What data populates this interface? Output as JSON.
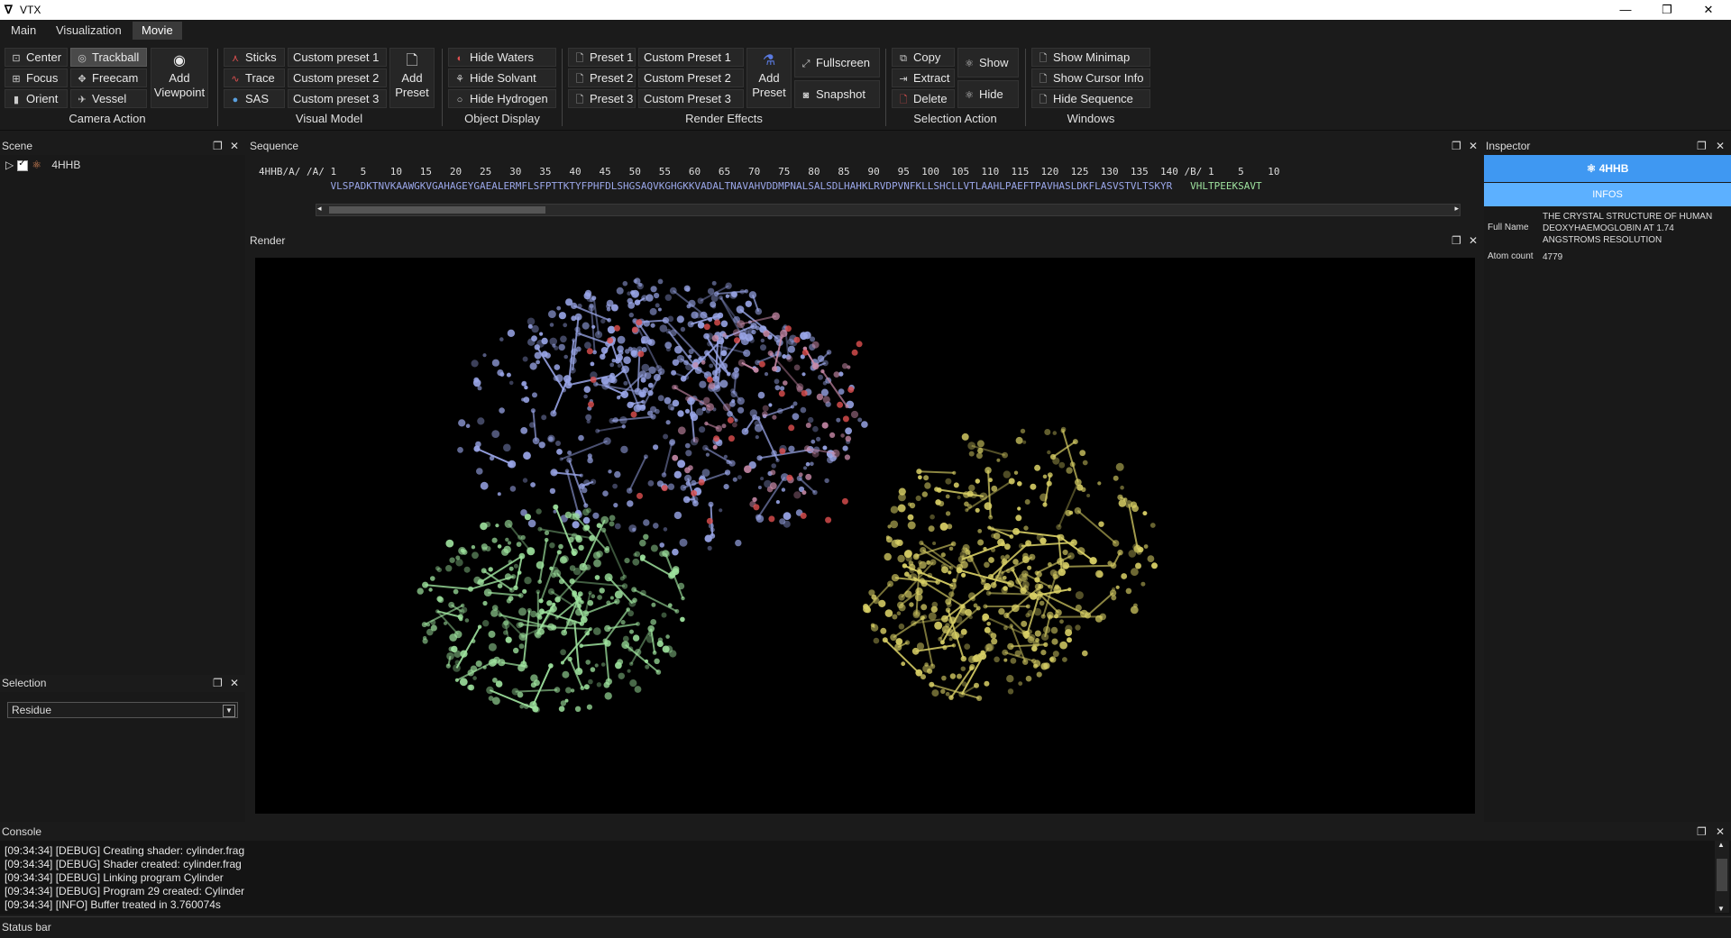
{
  "window": {
    "title": "VTX"
  },
  "menu": {
    "tabs": [
      "Main",
      "Visualization",
      "Movie"
    ]
  },
  "ribbon": {
    "camera": {
      "center": "Center",
      "trackball": "Trackball",
      "focus": "Focus",
      "freecam": "Freecam",
      "orient": "Orient",
      "vessel": "Vessel",
      "add_viewpoint_1": "Add",
      "add_viewpoint_2": "Viewpoint",
      "label": "Camera Action"
    },
    "visual_model": {
      "sticks": "Sticks",
      "trace": "Trace",
      "sas": "SAS",
      "custom1": "Custom preset 1",
      "custom2": "Custom preset 2",
      "custom3": "Custom preset 3",
      "add_preset_1": "Add",
      "add_preset_2": "Preset",
      "label": "Visual Model"
    },
    "object_display": {
      "hide_waters": "Hide Waters",
      "hide_solvant": "Hide Solvant",
      "hide_hydrogen": "Hide Hydrogen",
      "label": "Object Display"
    },
    "render_effects": {
      "preset1": "Preset 1",
      "preset2": "Preset 2",
      "preset3": "Preset 3",
      "custom1": "Custom Preset 1",
      "custom2": "Custom Preset 2",
      "custom3": "Custom Preset 3",
      "add_preset_1": "Add",
      "add_preset_2": "Preset",
      "fullscreen": "Fullscreen",
      "snapshot": "Snapshot",
      "label": "Render Effects"
    },
    "selection_action": {
      "copy": "Copy",
      "extract": "Extract",
      "delete": "Delete",
      "show": "Show",
      "hide": "Hide",
      "label": "Selection Action"
    },
    "windows": {
      "show_minimap": "Show Minimap",
      "show_cursor_info": "Show Cursor Info",
      "hide_sequence": "Hide Sequence",
      "label": "Windows"
    }
  },
  "scene": {
    "title": "Scene",
    "item": "4HHB"
  },
  "sequence": {
    "title": "Sequence",
    "numbers": "4HHB/A/ /A/ 1    5    10   15   20   25   30   35   40   45   50   55   60   65   70   75   80   85   90   95  100  105  110  115  120  125  130  135  140 /B/ 1    5    10",
    "residues_a": "            VLSPADKTNVKAAWGKVGAHAGEYGAEALERMFLSFPTTKTYFPHFDLSHGSAQVKGHGKKVADALTNAVAHVDDMPNALSALSDLHAHKLRVDPVNFKLLSHCLLVTLAAHLPAEFTPAVHASLDKFLASVSTVLTSKYR",
    "residues_b": "   VHLTPEEKSAVT"
  },
  "render": {
    "title": "Render"
  },
  "inspector": {
    "title": "Inspector",
    "molecule": "4HHB",
    "tab": "INFOS",
    "full_name_key": "Full Name",
    "full_name": "THE CRYSTAL STRUCTURE OF HUMAN DEOXYHAEMOGLOBIN AT 1.74 ANGSTROMS RESOLUTION",
    "atom_count_key": "Atom count",
    "atom_count": "4779"
  },
  "selection": {
    "title": "Selection",
    "mode": "Residue"
  },
  "console": {
    "title": "Console",
    "lines": [
      "[09:34:34] [DEBUG] Creating shader: cylinder.frag",
      "[09:34:34] [DEBUG] Shader created: cylinder.frag",
      "[09:34:34] [DEBUG] Linking program Cylinder",
      "[09:34:34] [DEBUG] Program 29 created: Cylinder",
      "[09:34:34] [INFO] Buffer treated in 3.760074s"
    ]
  },
  "status": {
    "text": "Status bar"
  },
  "colors": {
    "chain_a": "#9aa6e8",
    "chain_b": "#9ee29e",
    "chain_c": "#d9d066",
    "chain_d": "#c88aa8",
    "oxygen": "#e05050",
    "inspector_accent": "#3f98f2"
  }
}
